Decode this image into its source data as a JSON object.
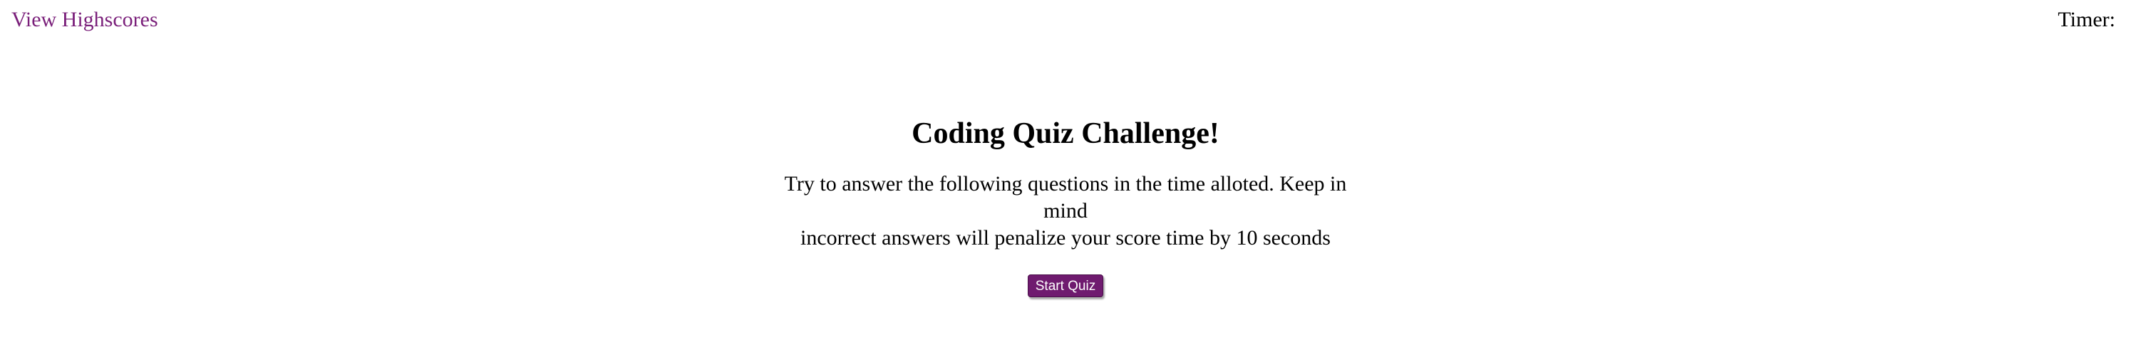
{
  "header": {
    "highscores_link": "View Highscores",
    "timer_label": "Timer:",
    "timer_value": ""
  },
  "quiz": {
    "title": "Coding Quiz Challenge!",
    "intro_line1": "Try to answer the following questions in the time alloted. Keep in mind",
    "intro_line2": "incorrect answers will penalize your score time by 10 seconds",
    "start_button": "Start Quiz"
  },
  "colors": {
    "link": "#7a1f7a",
    "button_bg": "#6f1b6f",
    "button_text": "#ffffff",
    "text": "#000000",
    "background": "#ffffff"
  }
}
